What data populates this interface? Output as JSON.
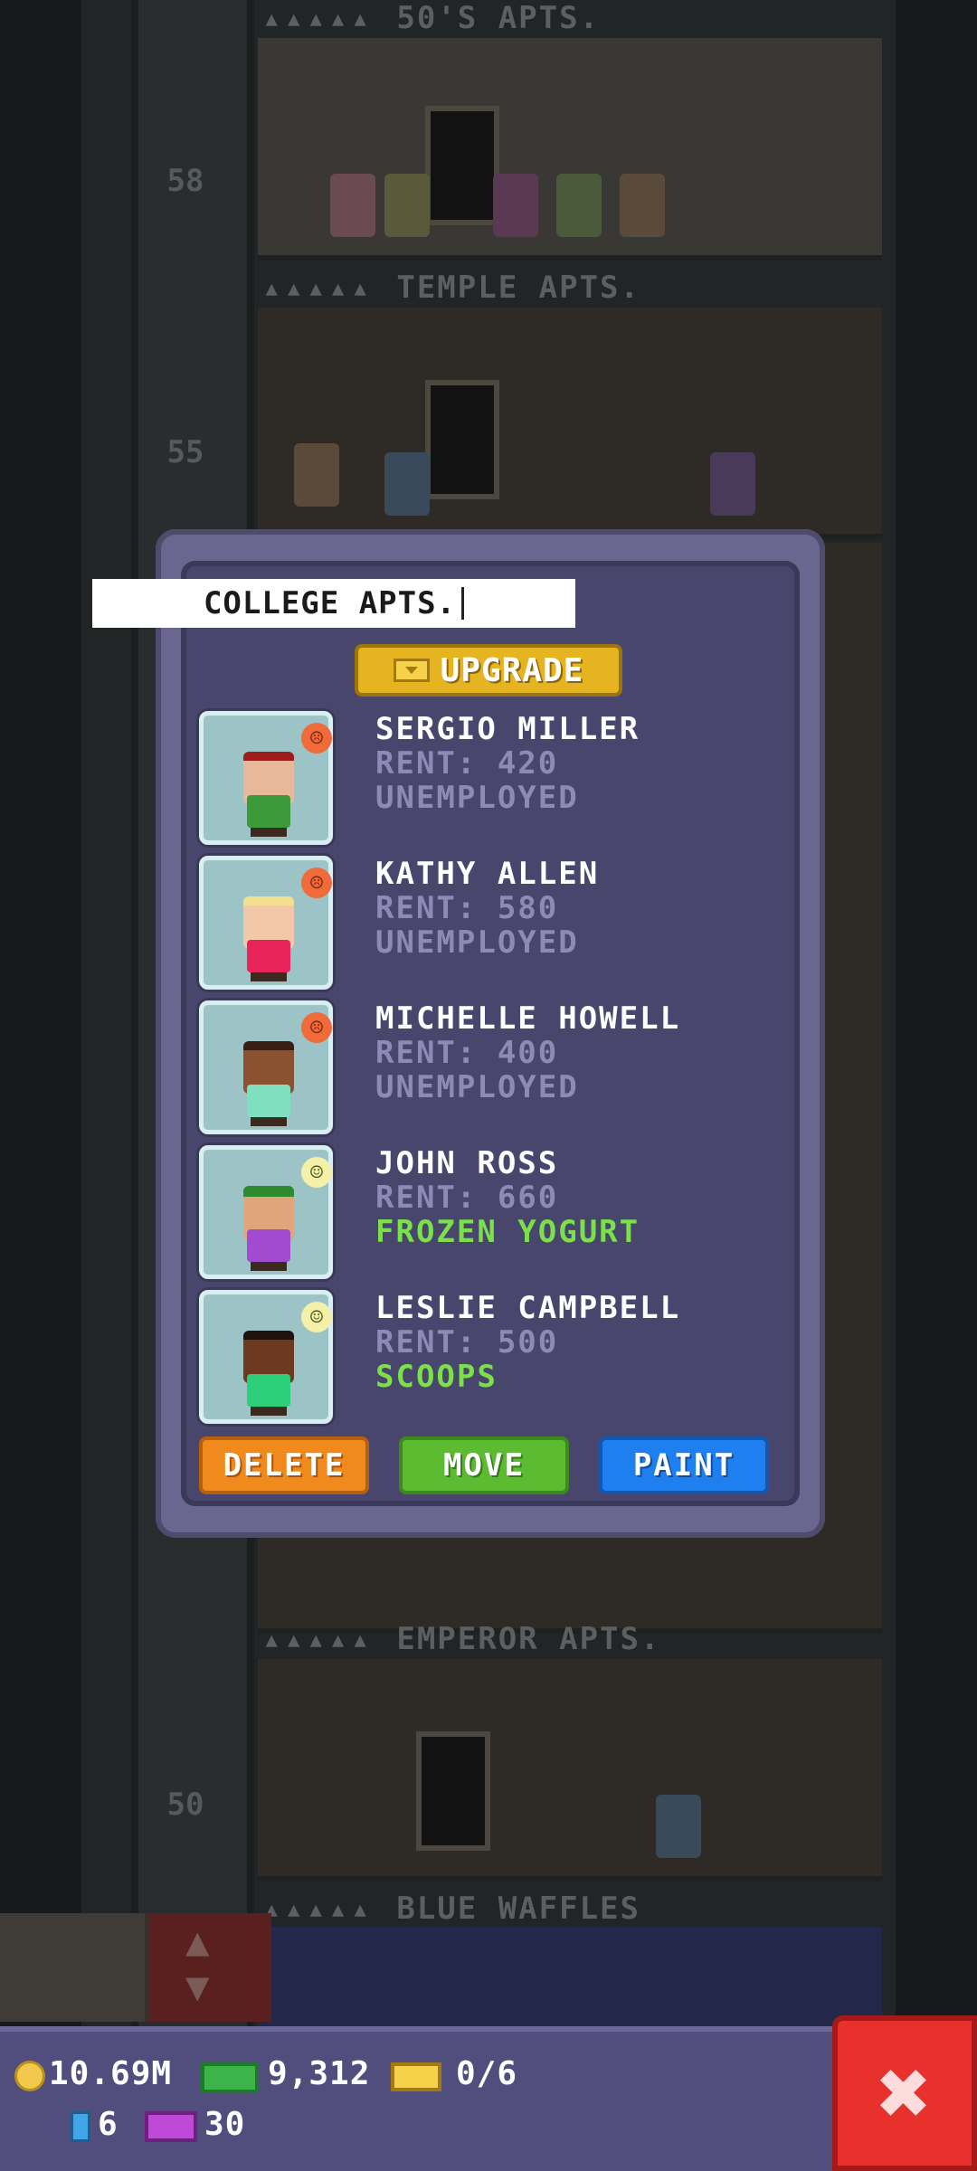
{
  "background": {
    "floors": [
      {
        "label": "50'S APTS.",
        "number": ""
      },
      {
        "label": "TEMPLE APTS.",
        "number": ""
      },
      {
        "label": "EMPEROR APTS.",
        "number": "50"
      },
      {
        "label": "BLUE WAFFLES",
        "number": ""
      }
    ],
    "floor_numbers": [
      "58",
      "55"
    ],
    "dots": "▴▴▴▴▴"
  },
  "dialog": {
    "title": "COLLEGE APTS.",
    "upgrade_label": "UPGRADE",
    "residents": [
      {
        "name": "SERGIO MILLER",
        "rent": "RENT: 420",
        "job": "UNEMPLOYED",
        "mood": "sad",
        "skin": "#e8b89a",
        "shirt": "#3d9a3a",
        "hair": "#9e1c1c"
      },
      {
        "name": "KATHY ALLEN",
        "rent": "RENT: 580",
        "job": "UNEMPLOYED",
        "mood": "sad",
        "skin": "#f2c8a8",
        "shirt": "#e8245a",
        "hair": "#f4df8e"
      },
      {
        "name": "MICHELLE HOWELL",
        "rent": "RENT: 400",
        "job": "UNEMPLOYED",
        "mood": "sad",
        "skin": "#8a5230",
        "shirt": "#7fe0c0",
        "hair": "#3a1e12"
      },
      {
        "name": "JOHN ROSS",
        "rent": "RENT: 660",
        "job": "FROZEN YOGURT",
        "mood": "neutral",
        "skin": "#e0a57a",
        "shirt": "#a24ad0",
        "hair": "#2e8a2e"
      },
      {
        "name": "LESLIE CAMPBELL",
        "rent": "RENT: 500",
        "job": "SCOOPS",
        "mood": "neutral",
        "skin": "#6b3a20",
        "shirt": "#2ecf7a",
        "hair": "#1e120c"
      }
    ],
    "buttons": {
      "delete": "DELETE",
      "move": "MOVE",
      "paint": "PAINT"
    }
  },
  "status": {
    "coins": "10.69M",
    "cash": "9,312",
    "golden_bux": "0/6",
    "elevators": "6",
    "vip": "30"
  },
  "colors": {
    "dialog_bg": "#48466d",
    "employed": "#7ce04a",
    "unemployed": "#8d8bb5",
    "close": "#e8302c"
  },
  "icons": [
    "coin-icon",
    "cash-icon",
    "golden-bux-icon",
    "elevator-icon",
    "vip-icon",
    "close-icon",
    "sad-mood-icon",
    "neutral-mood-icon"
  ]
}
